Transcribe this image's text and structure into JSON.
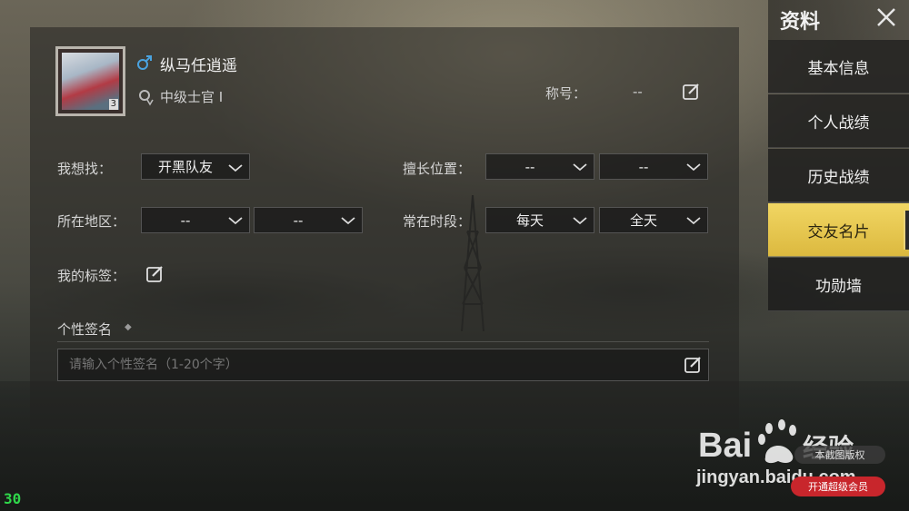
{
  "profile": {
    "name": "纵马任逍遥",
    "gender_icon": "male-icon",
    "rank": "中级士官 I",
    "avatar_level": "3",
    "title_label": "称号：",
    "title_value": "--"
  },
  "fields": {
    "looking_for_label": "我想找：",
    "looking_for_value": "开黑队友",
    "region_label": "所在地区：",
    "region_value_1": "--",
    "region_value_2": "--",
    "position_label": "擅长位置：",
    "position_value_1": "--",
    "position_value_2": "--",
    "time_label": "常在时段：",
    "time_value_1": "每天",
    "time_value_2": "全天",
    "tags_label": "我的标签："
  },
  "signature": {
    "label": "个性签名",
    "dot": "◆",
    "placeholder": "请输入个性签名（1-20个字）"
  },
  "menu": {
    "title": "资料",
    "items": [
      {
        "label": "基本信息"
      },
      {
        "label": "个人战绩"
      },
      {
        "label": "历史战绩"
      },
      {
        "label": "交友名片"
      },
      {
        "label": "功勋墙"
      }
    ],
    "active_index": 3
  },
  "fps": "30",
  "watermark": {
    "brand": "Baidu经验",
    "url": "jingyan.baidu.com",
    "pill_dark": "本截图版权",
    "pill_red": "开通超级会员"
  },
  "colors": {
    "accent": "#e8c84e",
    "fps": "#2fd64a",
    "pill_red": "#c8262c"
  }
}
